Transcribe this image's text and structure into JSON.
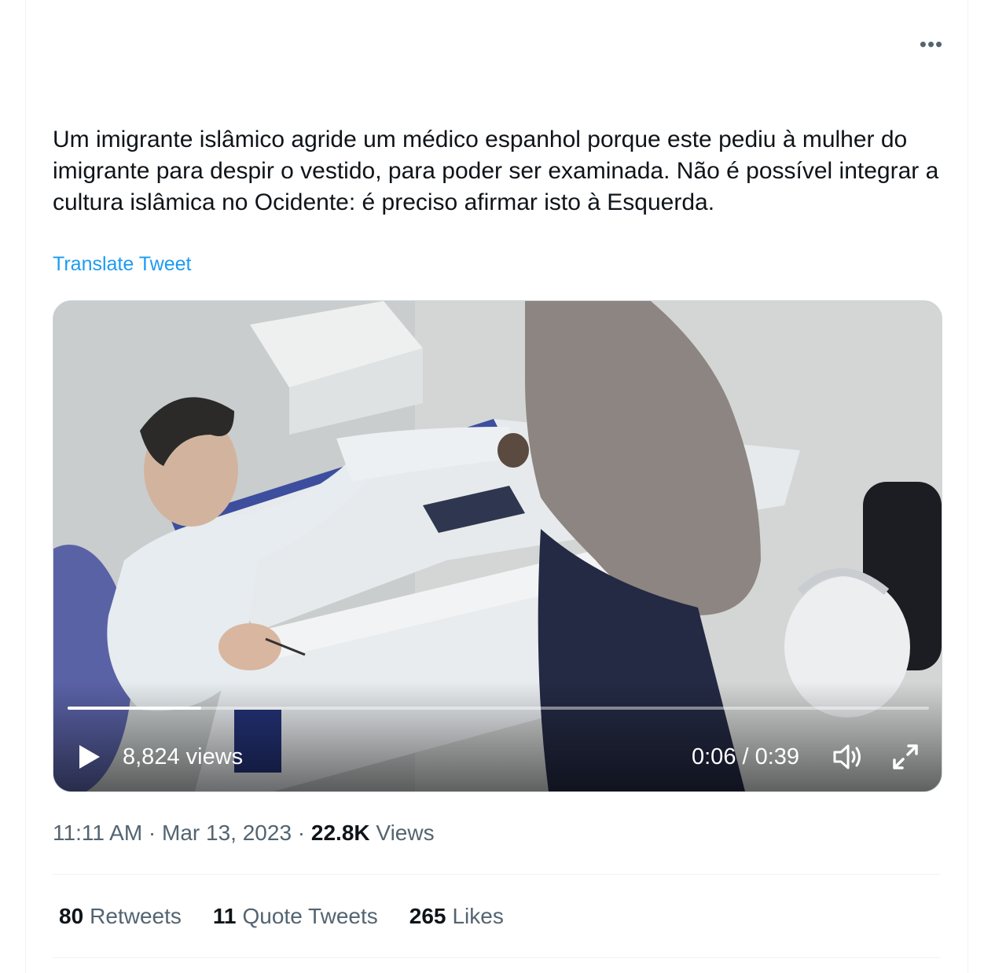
{
  "tweet": {
    "more_icon": "more-horizontal-icon",
    "text": "Um imigrante islâmico agride um médico espanhol porque este pediu à mulher do imigrante para despir o vestido, para poder ser examinada. Não é possível integrar a cultura islâmica no Ocidente: é preciso afirmar isto à Esquerda.",
    "translate_label": "Translate Tweet",
    "timestamp": "11:11 AM · Mar 13, 2023 · ",
    "views_count": "22.8K",
    "views_label": " Views"
  },
  "video": {
    "view_count": "8,824 views",
    "time": "0:06 / 0:39",
    "progress": 0.155,
    "icons": {
      "play": "play-icon",
      "volume": "volume-icon",
      "fullscreen": "fullscreen-icon"
    }
  },
  "stats": {
    "retweets_count": "80",
    "retweets_label": "Retweets",
    "quotes_count": "11",
    "quotes_label": "Quote Tweets",
    "likes_count": "265",
    "likes_label": "Likes"
  },
  "colors": {
    "link": "#1d9bf0",
    "secondary_text": "#536471",
    "primary_text": "#0f1419"
  }
}
